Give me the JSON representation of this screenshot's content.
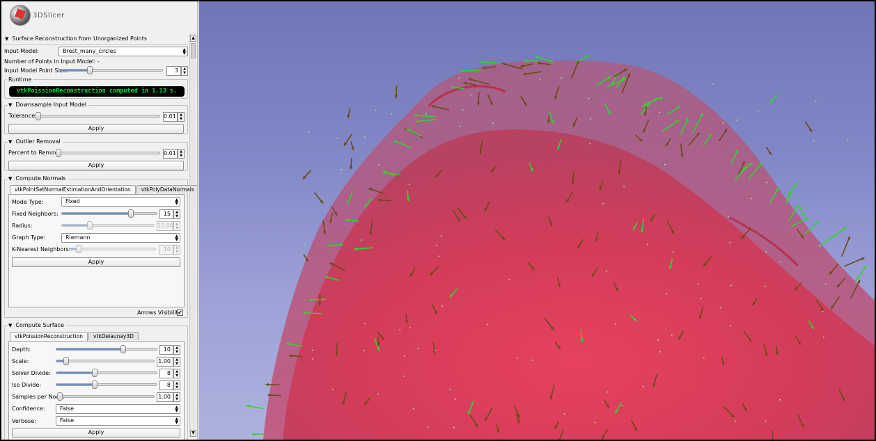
{
  "app": {
    "title": "3DSlicer"
  },
  "module": {
    "title": "Surface Reconstruction from Unorganized Points",
    "input_model_label": "Input Model:",
    "input_model_value": "Brest_many_circles",
    "num_points_label": "Number of Points in Input Model: -",
    "point_size_label": "Input Model Point Size:",
    "point_size_value": "3",
    "point_size_level": 0.3
  },
  "runtime": {
    "title": "Runtime",
    "message": "vtkPoissionReconstruction computed in 1.13 s."
  },
  "downsample": {
    "title": "Downsample Input Model",
    "tolerance_label": "Tolerance:",
    "tolerance_value": "0.01",
    "tolerance_level": 0.01,
    "apply_label": "Apply"
  },
  "outlier": {
    "title": "Outlier Removal",
    "percent_label": "Percent to Remove:",
    "percent_value": "0.01",
    "percent_level": 0.01,
    "apply_label": "Apply"
  },
  "normals": {
    "title": "Compute Normals",
    "tabs": [
      "vtkPointSetNormalEstimationAndOrientation",
      "vtkPolyDataNormals"
    ],
    "mode_label": "Mode Type:",
    "mode_value": "Fixed",
    "fixed_neighbors_label": "Fixed Neighbors:",
    "fixed_neighbors_value": "15",
    "fixed_neighbors_level": 0.73,
    "radius_label": "Radius:",
    "radius_value": "15.00",
    "radius_level": 0.3,
    "graph_label": "Graph Type:",
    "graph_value": "Riemann",
    "knn_label": "K-Nearest Neighbors:",
    "knn_value": "10",
    "knn_level": 0.1,
    "apply_label": "Apply",
    "arrows_label": "Arrows Visibility:",
    "arrows_checked": "✔"
  },
  "surface": {
    "title": "Compute Surface",
    "tabs": [
      "vtkPoissionReconstruction",
      "vtkDelaunay3D"
    ],
    "depth_label": "Depth:",
    "depth_value": "10",
    "depth_level": 0.67,
    "scale_label": "Scale:",
    "scale_value": "1.00",
    "scale_level": 0.1,
    "solver_label": "Solver Divide:",
    "solver_value": "8",
    "solver_level": 0.38,
    "iso_label": "Iso Divide:",
    "iso_value": "8",
    "iso_level": 0.38,
    "samples_label": "Samples per Node:",
    "samples_value": "1.00",
    "samples_level": 0.02,
    "confidence_label": "Confidence:",
    "confidence_value": "False",
    "verbose_label": "Verbose:",
    "verbose_value": "False",
    "apply_label": "Apply"
  },
  "colors": {
    "surface": "#d83a55",
    "arrow_green": "#2fd52f",
    "arrow_dark": "#6b4a14",
    "background_top": "#6f75b6",
    "background_bottom": "#aeb2de"
  }
}
